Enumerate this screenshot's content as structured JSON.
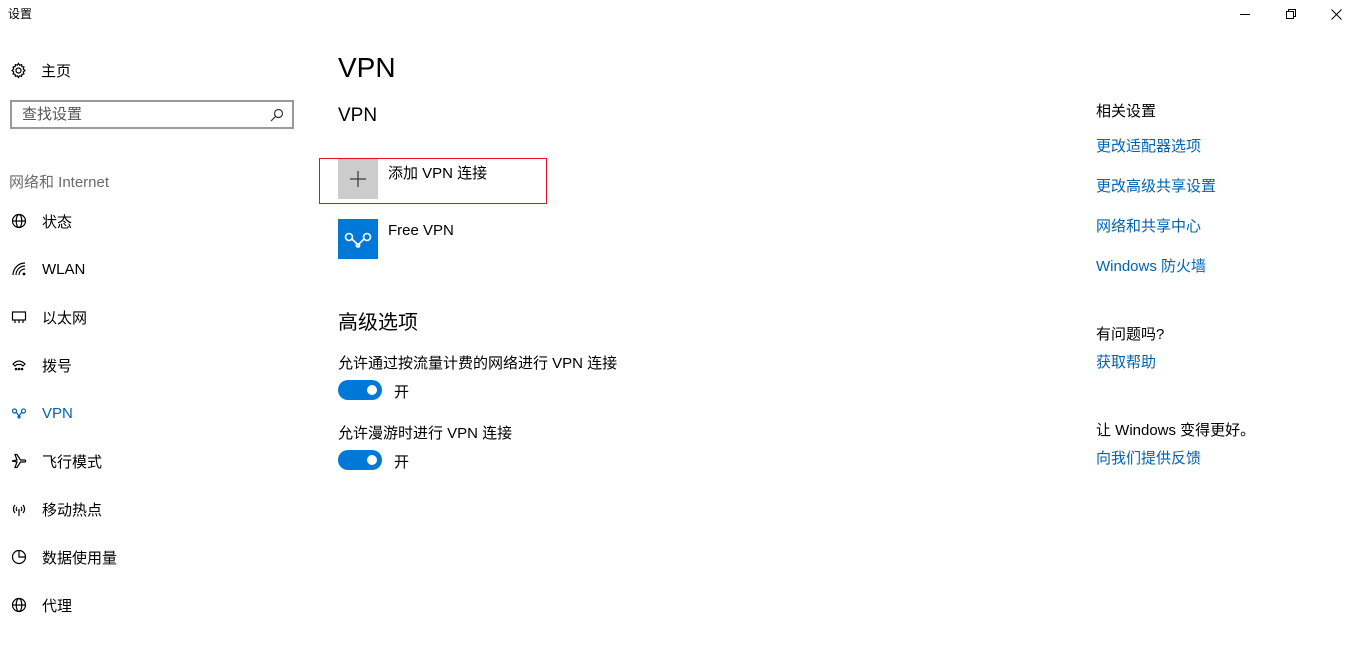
{
  "window": {
    "title": "设置"
  },
  "sidebar": {
    "home_label": "主页",
    "search_placeholder": "查找设置",
    "section_label": "网络和 Internet",
    "items": [
      {
        "label": "状态",
        "icon": "globe-status-icon"
      },
      {
        "label": "WLAN",
        "icon": "wifi-icon"
      },
      {
        "label": "以太网",
        "icon": "ethernet-icon"
      },
      {
        "label": "拨号",
        "icon": "dialup-icon"
      },
      {
        "label": "VPN",
        "icon": "vpn-icon",
        "active": true
      },
      {
        "label": "飞行模式",
        "icon": "airplane-icon"
      },
      {
        "label": "移动热点",
        "icon": "hotspot-icon"
      },
      {
        "label": "数据使用量",
        "icon": "data-usage-icon"
      },
      {
        "label": "代理",
        "icon": "globe-icon"
      }
    ]
  },
  "main": {
    "page_title": "VPN",
    "section_title": "VPN",
    "add_vpn_label": "添加 VPN 连接",
    "vpn_connections": [
      {
        "name": "Free VPN"
      }
    ],
    "advanced_title": "高级选项",
    "options": [
      {
        "label": "允许通过按流量计费的网络进行 VPN 连接",
        "state": "开",
        "on": true
      },
      {
        "label": "允许漫游时进行 VPN 连接",
        "state": "开",
        "on": true
      }
    ]
  },
  "related": {
    "heading": "相关设置",
    "links": [
      "更改适配器选项",
      "更改高级共享设置",
      "网络和共享中心",
      "Windows 防火墙"
    ],
    "question_heading": "有问题吗?",
    "help_link": "获取帮助",
    "feedback_heading": "让 Windows 变得更好。",
    "feedback_link": "向我们提供反馈"
  },
  "colors": {
    "accent": "#0078d7",
    "link": "#0063b1",
    "highlight_box": "#e81123"
  }
}
